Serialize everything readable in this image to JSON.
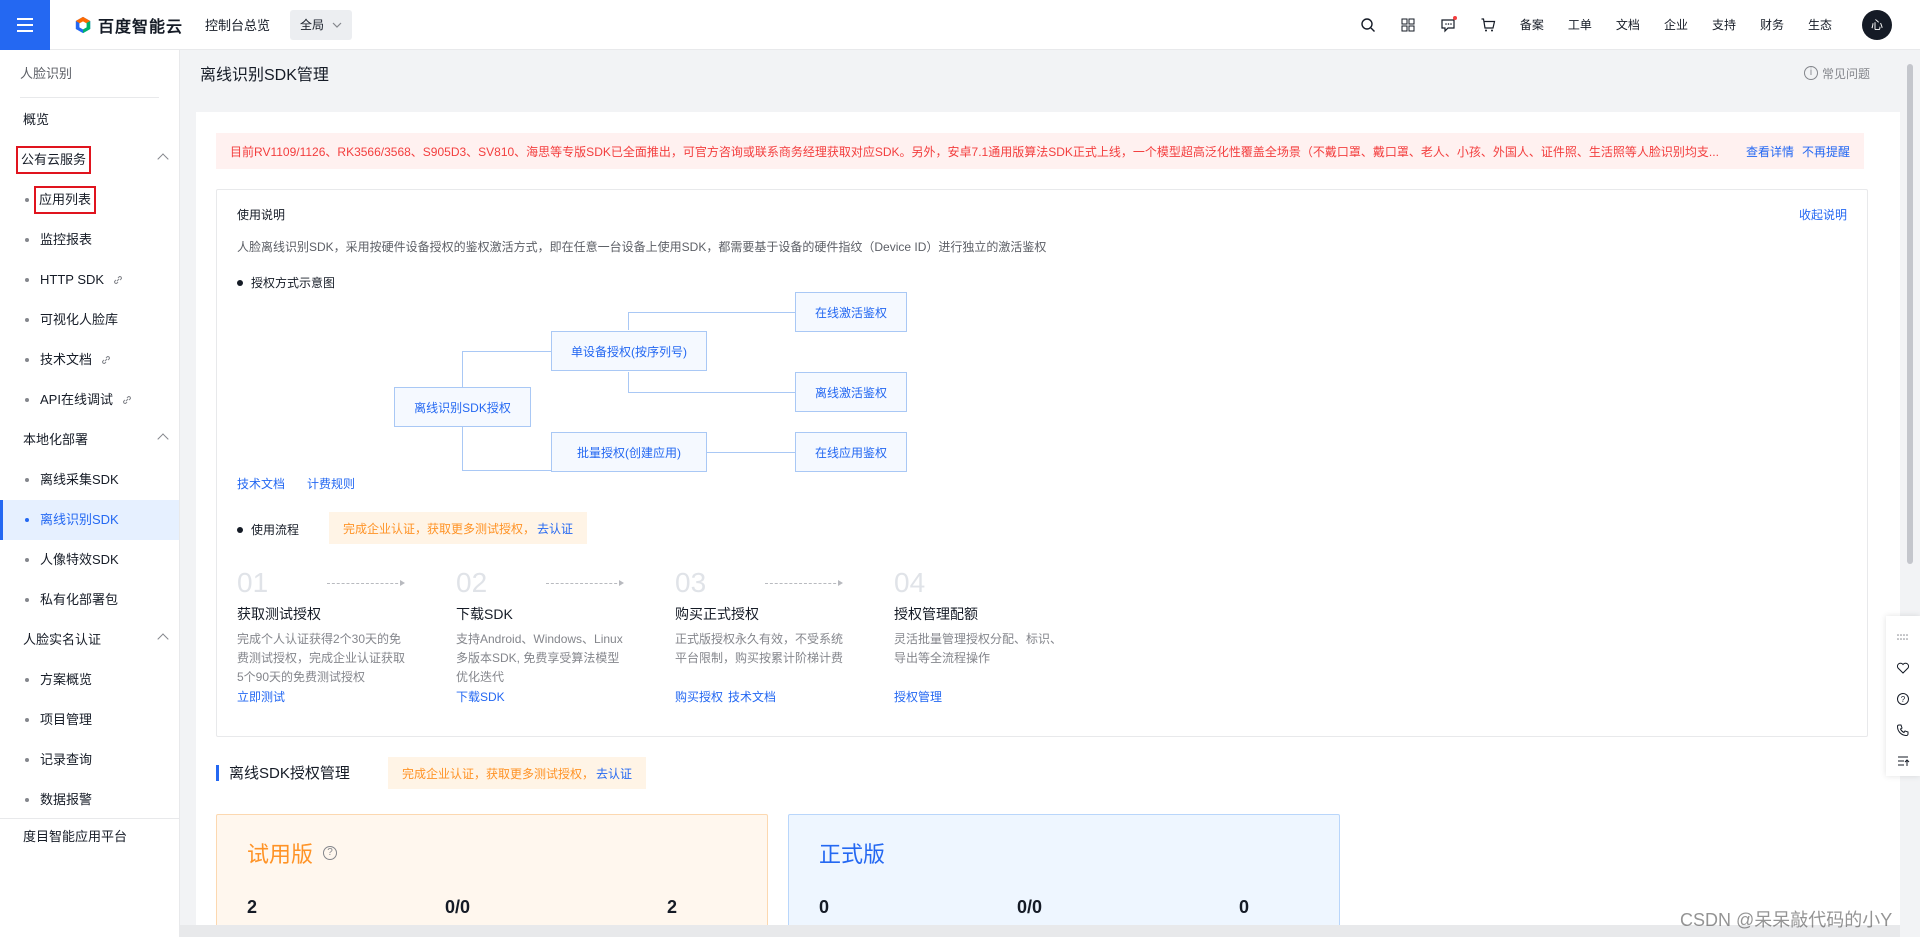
{
  "header": {
    "brand": "百度智能云",
    "console_link": "控制台总览",
    "region": "全局",
    "nav": [
      "备案",
      "工单",
      "文档",
      "企业",
      "支持",
      "财务",
      "生态"
    ],
    "avatar_text": "心"
  },
  "sidebar": {
    "title": "人脸识别",
    "overview": "概览",
    "groups": [
      {
        "label": "公有云服务",
        "items": [
          "应用列表",
          "监控报表",
          "HTTP SDK",
          "可视化人脸库",
          "技术文档",
          "API在线调试"
        ]
      },
      {
        "label": "本地化部署",
        "items": [
          "离线采集SDK",
          "离线识别SDK",
          "人像特效SDK",
          "私有化部署包"
        ]
      },
      {
        "label": "人脸实名认证",
        "items": [
          "方案概览",
          "项目管理",
          "记录查询",
          "数据报警"
        ]
      }
    ],
    "bottom": "度目智能应用平台"
  },
  "page": {
    "title": "离线识别SDK管理",
    "faq": "常见问题"
  },
  "notice": {
    "text": "目前RV1109/1126、RK3566/3568、S905D3、SV810、海思等专版SDK已全面推出，可官方咨询或联系商务经理获取对应SDK。另外，安卓7.1通用版算法SDK正式上线，一个模型超高泛化性覆盖全场景（不戴口罩、戴口罩、老人、小孩、外国人、证件照、生活照等人脸识别均支...",
    "view_detail": "查看详情",
    "dismiss": "不再提醒"
  },
  "usage": {
    "label": "使用说明",
    "collapse": "收起说明",
    "description": "人脸离线识别SDK，采用按硬件设备授权的鉴权激活方式，即在任意一台设备上使用SDK，都需要基于设备的硬件指纹（Device ID）进行独立的激活鉴权",
    "diagram_bullet": "授权方式示意图",
    "diagram": {
      "root": "离线识别SDK授权",
      "single": "单设备授权(按序列号)",
      "batch": "批量授权(创建应用)",
      "online_activate": "在线激活鉴权",
      "offline_activate": "离线激活鉴权",
      "online_app": "在线应用鉴权"
    },
    "doc_links": [
      "技术文档",
      "计费规则"
    ],
    "flow_bullet": "使用流程",
    "cert_tip": "完成企业认证，获取更多测试授权，",
    "cert_link": "去认证",
    "steps": [
      {
        "num": "01",
        "title": "获取测试授权",
        "desc": "完成个人认证获得2个30天的免费测试授权，完成企业认证获取5个90天的免费测试授权",
        "links": [
          "立即测试"
        ]
      },
      {
        "num": "02",
        "title": "下载SDK",
        "desc": "支持Android、Windows、Linux多版本SDK, 免费享受算法模型优化迭代",
        "links": [
          "下载SDK"
        ]
      },
      {
        "num": "03",
        "title": "购买正式授权",
        "desc": "正式版授权永久有效，不受系统平台限制，购买按累计阶梯计费",
        "links": [
          "购买授权",
          "技术文档"
        ]
      },
      {
        "num": "04",
        "title": "授权管理配额",
        "desc": "灵活批量管理授权分配、标识、导出等全流程操作",
        "links": [
          "授权管理"
        ]
      }
    ]
  },
  "auth": {
    "title": "离线SDK授权管理",
    "cert_tip": "完成企业认证，获取更多测试授权，",
    "cert_link": "去认证",
    "trial": {
      "title": "试用版",
      "values": [
        "2",
        "0/0",
        "2"
      ]
    },
    "formal": {
      "title": "正式版",
      "values": [
        "0",
        "0/0",
        "0"
      ]
    }
  },
  "watermark": "CSDN @呆呆敲代码的小Y",
  "colors": {
    "primary": "#2468f2",
    "warning": "#ff9326",
    "danger": "#f33e3e"
  }
}
